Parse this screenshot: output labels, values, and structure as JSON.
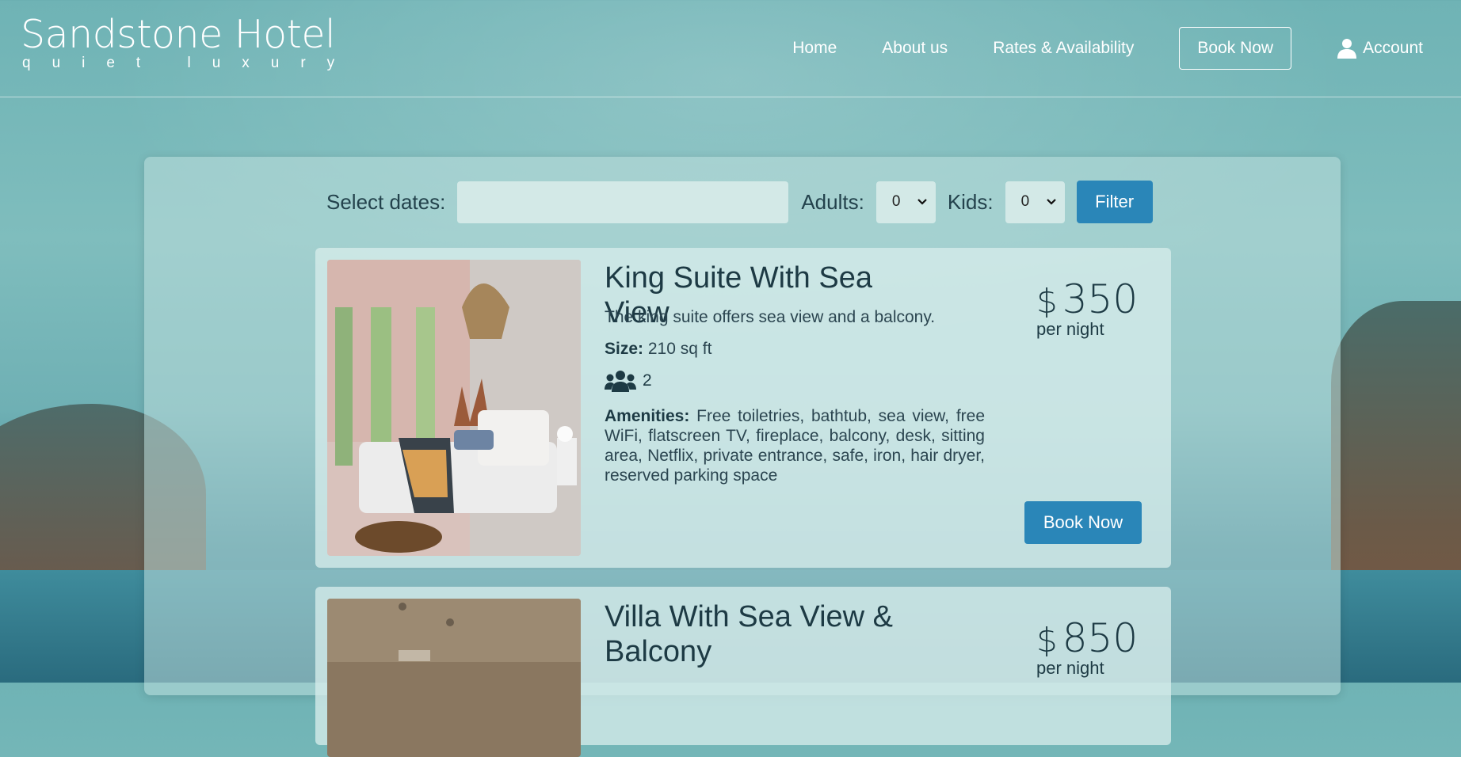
{
  "brand": {
    "title": "Sandstone Hotel",
    "tagline": "quiet luxury"
  },
  "nav": {
    "home": "Home",
    "about": "About us",
    "rates": "Rates & Availability",
    "book": "Book Now",
    "account": "Account"
  },
  "filter": {
    "dates_label": "Select dates:",
    "dates_value": "",
    "adults_label": "Adults:",
    "adults_value": "0",
    "kids_label": "Kids:",
    "kids_value": "0",
    "button": "Filter"
  },
  "rooms": [
    {
      "name": "King Suite With Sea View",
      "description": "The king suite offers sea view and a balcony.",
      "size_label": "Size:",
      "size_value": "210 sq ft",
      "guests": "2",
      "amenities_label": "Amenities:",
      "amenities": "Free toiletries, bathtub, sea view, free WiFi, flatscreen TV, fireplace, balcony, desk, sitting area, Netflix, private entrance, safe, iron, hair dryer, reserved parking space",
      "currency": "$",
      "price": "350",
      "per": "per night",
      "book": "Book Now"
    },
    {
      "name": "Villa With Sea View & Balcony",
      "currency": "$",
      "price": "850",
      "per": "per night"
    }
  ],
  "colors": {
    "accent": "#2a86b8",
    "text": "#1d3a44"
  }
}
